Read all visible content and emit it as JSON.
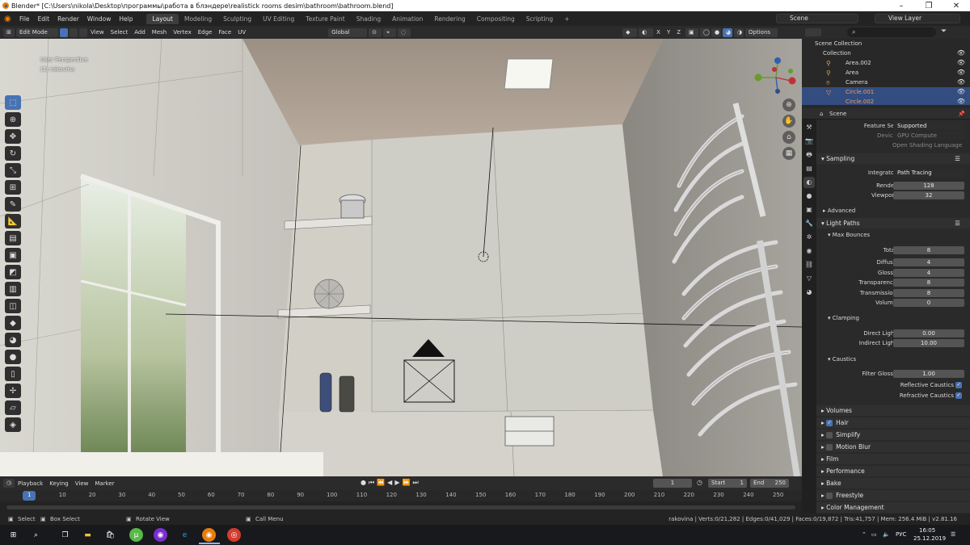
{
  "window": {
    "title": "Blender* [C:\\Users\\nikola\\Desktop\\программы\\работа в блэндере\\realistick rooms desim\\bathroom\\bathroom.blend]",
    "minimize": "–",
    "maximize": "❐",
    "close": "✕"
  },
  "menu": [
    "File",
    "Edit",
    "Render",
    "Window",
    "Help"
  ],
  "workspaces": [
    "Layout",
    "Modeling",
    "Sculpting",
    "UV Editing",
    "Texture Paint",
    "Shading",
    "Animation",
    "Rendering",
    "Compositing",
    "Scripting"
  ],
  "active_workspace": "Layout",
  "add_workspace": "+",
  "scene_field": "Scene",
  "view_layer_field": "View Layer",
  "viewport_header": {
    "mode": "Edit Mode",
    "menus": [
      "View",
      "Select",
      "Add",
      "Mesh",
      "Vertex",
      "Edge",
      "Face",
      "UV"
    ],
    "transform": "Global",
    "axes": [
      "X",
      "Y",
      "Z"
    ],
    "options": "Options"
  },
  "viewport": {
    "view_name": "User Perspective",
    "object_info": "(1) rakovina",
    "gizmo": [
      "X",
      "Y",
      "Z"
    ]
  },
  "tools": [
    "cursor",
    "select",
    "move",
    "rotate",
    "scale",
    "transform",
    "annotate",
    "measure",
    "extrude",
    "inset",
    "bevel",
    "loop-cut",
    "knife",
    "poly-build",
    "spin",
    "smooth",
    "edge-slide",
    "shrink",
    "shear",
    "rip"
  ],
  "outliner": {
    "root": "Scene Collection",
    "items": [
      {
        "name": "Collection",
        "selected": false
      },
      {
        "name": "Area.002",
        "selected": false
      },
      {
        "name": "Area",
        "selected": false
      },
      {
        "name": "Camera",
        "selected": false
      },
      {
        "name": "Circle.001",
        "selected": true
      },
      {
        "name": "Circle.002",
        "selected": true
      }
    ]
  },
  "properties": {
    "context": "Scene",
    "device_label": "Device",
    "device_value": "GPU Compute",
    "feature_label": "Feature Set",
    "feature_value": "Supported",
    "open_shading": "Open Shading Language",
    "sampling": "Sampling",
    "integrator_label": "Integrator",
    "integrator_value": "Path Tracing",
    "render_label": "Render",
    "render_value": "128",
    "viewport_label": "Viewport",
    "viewport_value": "32",
    "advanced": "Advanced",
    "light_paths": "Light Paths",
    "max_bounces": "Max Bounces",
    "bounces": [
      {
        "label": "Total",
        "value": "8"
      },
      {
        "label": "Diffuse",
        "value": "4"
      },
      {
        "label": "Glossy",
        "value": "4"
      },
      {
        "label": "Transparency",
        "value": "8"
      },
      {
        "label": "Transmission",
        "value": "8"
      },
      {
        "label": "Volume",
        "value": "0"
      }
    ],
    "clamping": "Clamping",
    "direct_light_label": "Direct Light",
    "direct_light_value": "0.00",
    "indirect_light_label": "Indirect Light",
    "indirect_light_value": "10.00",
    "caustics": "Caustics",
    "filter_glossy_label": "Filter Glossy",
    "filter_glossy_value": "1.00",
    "reflective_caustics": "Reflective Caustics",
    "refractive_caustics": "Refractive Caustics",
    "panels": [
      {
        "label": "Volumes",
        "checkbox": null
      },
      {
        "label": "Hair",
        "checkbox": true
      },
      {
        "label": "Simplify",
        "checkbox": false
      },
      {
        "label": "Motion Blur",
        "checkbox": false
      },
      {
        "label": "Film",
        "checkbox": null
      },
      {
        "label": "Performance",
        "checkbox": null
      },
      {
        "label": "Bake",
        "checkbox": null
      },
      {
        "label": "Freestyle",
        "checkbox": false
      },
      {
        "label": "Color Management",
        "checkbox": null
      }
    ]
  },
  "timeline": {
    "menus": [
      "Playback",
      "Keying",
      "View",
      "Marker"
    ],
    "current_frame": "1",
    "start_label": "Start",
    "start_value": "1",
    "end_label": "End",
    "end_value": "250",
    "ticks": [
      "1",
      "10",
      "20",
      "30",
      "40",
      "50",
      "60",
      "70",
      "80",
      "90",
      "100",
      "110",
      "120",
      "130",
      "140",
      "150",
      "160",
      "170",
      "180",
      "190",
      "200",
      "210",
      "220",
      "230",
      "240",
      "250"
    ]
  },
  "statusbar": {
    "select": "Select",
    "box_select": "Box Select",
    "rotate_view": "Rotate View",
    "call_menu": "Call Menu",
    "stats": "rakovina | Verts:0/21,282 | Edges:0/41,029 | Faces:0/19,872 | Tris:41,757 | Mem: 256.4 MiB | v2.81.16"
  },
  "taskbar": {
    "language": "РУС",
    "time": "16:05",
    "date": "25.12.2019"
  },
  "colors": {
    "accent": "#4772b3",
    "blender_orange": "#e87d0d",
    "selected_row": "#334d80"
  }
}
